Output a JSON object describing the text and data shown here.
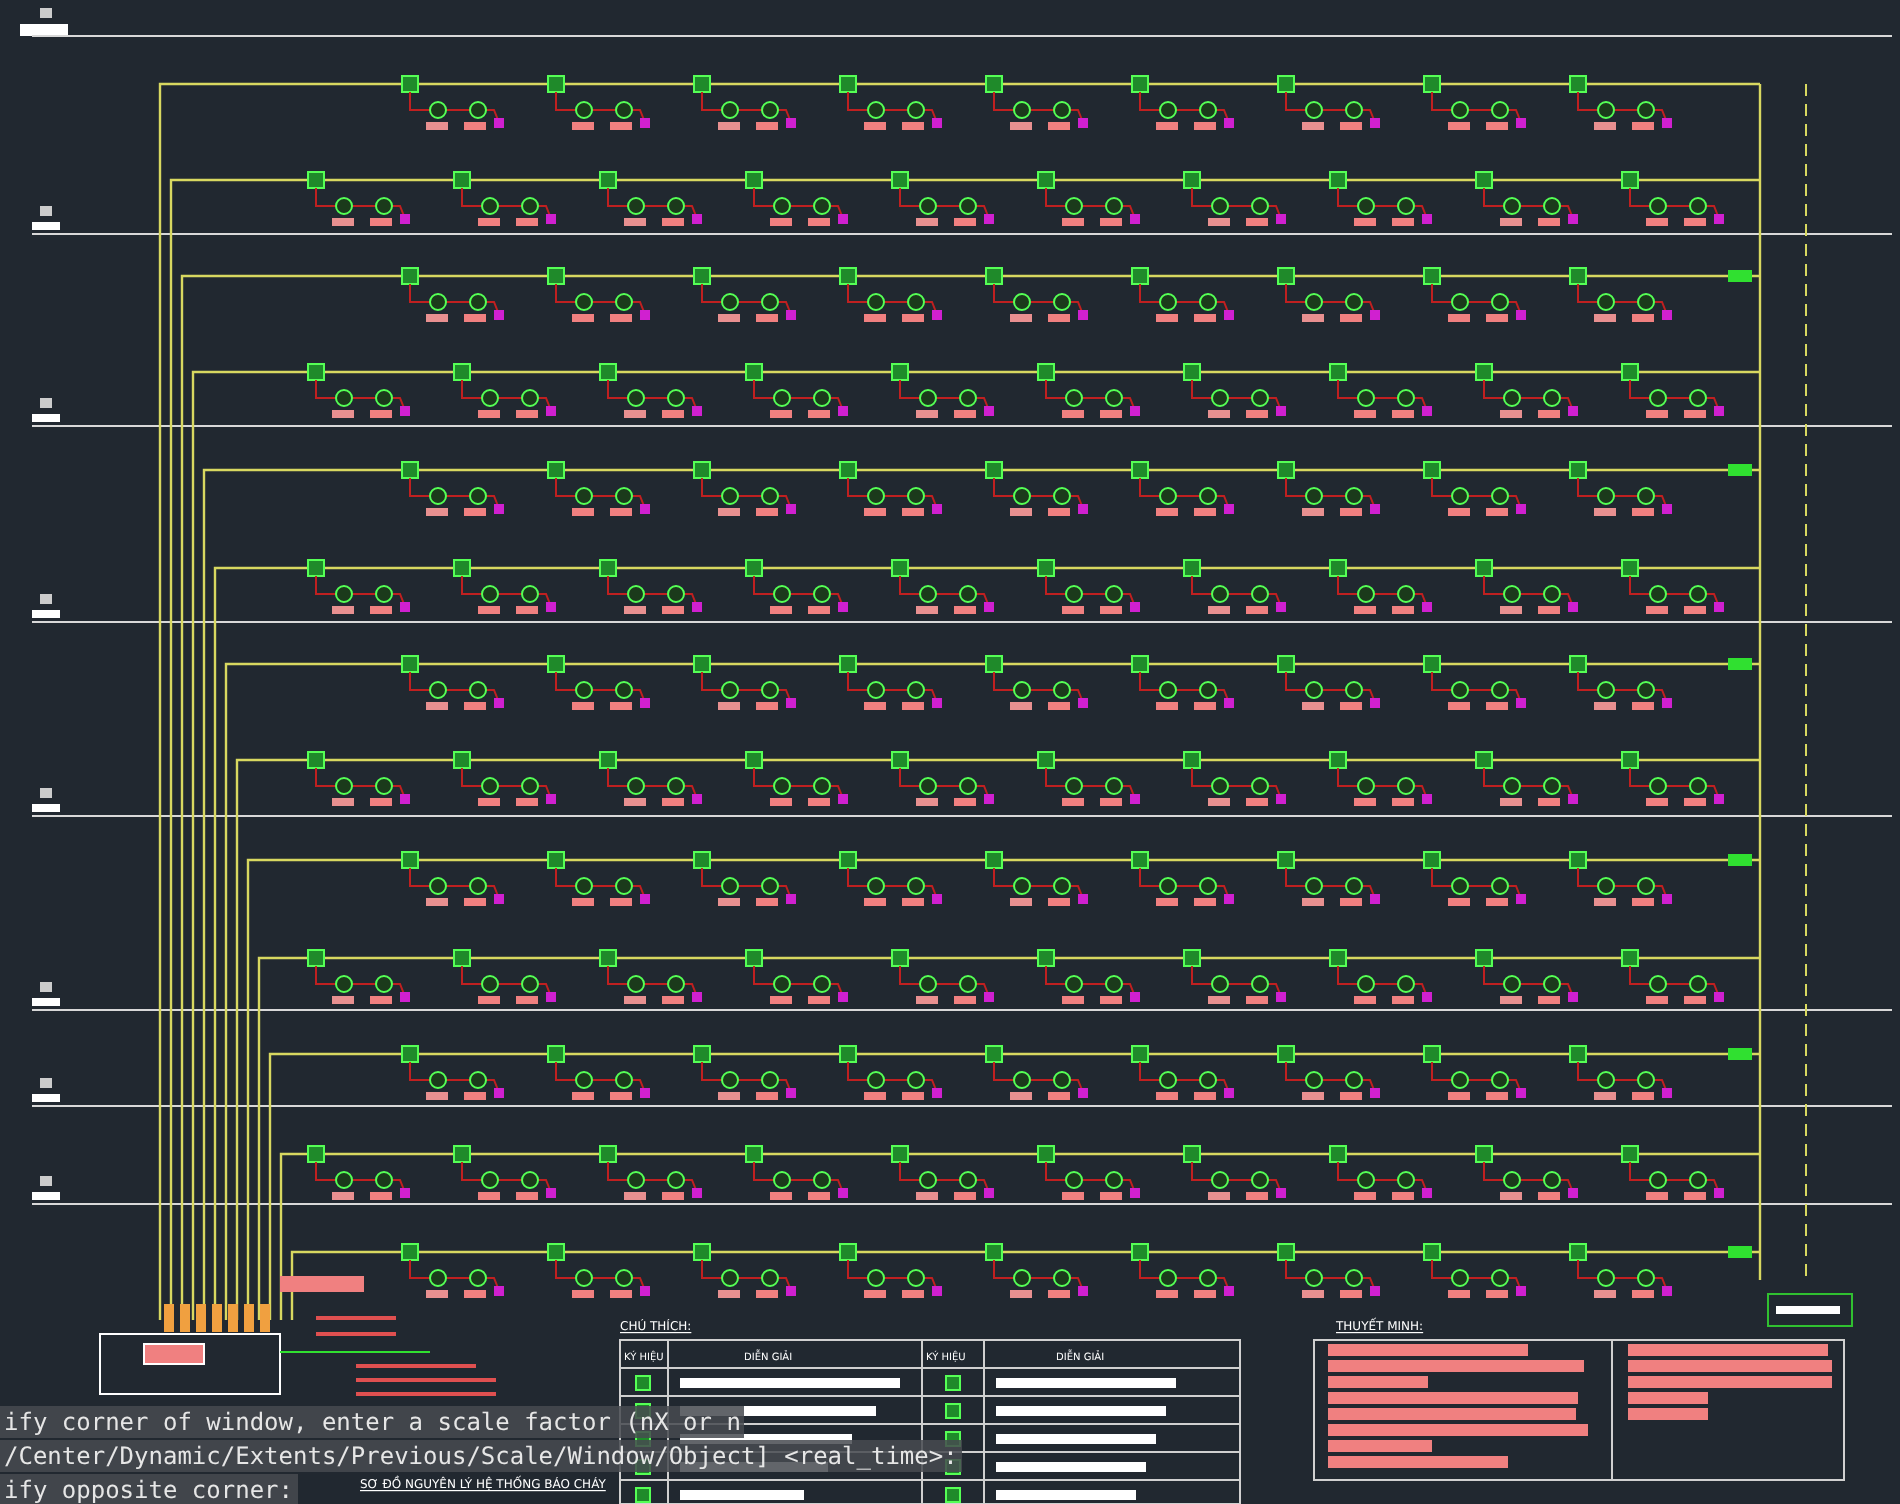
{
  "drawing": {
    "title": "SƠ ĐỒ NGUYÊN LÝ HỆ THỐNG BÁO CHÁY"
  },
  "legend": {
    "title": "CHÚ THÍCH:",
    "columns": [
      "KÝ HIỆU",
      "DIỄN GIẢI",
      "KÝ HIỆU",
      "DIỄN GIẢI"
    ]
  },
  "notes": {
    "title": "THUYẾT MINH:"
  },
  "command_line": {
    "lines": [
      "ify corner of window, enter a scale factor (nX or n",
      "/Center/Dynamic/Extents/Previous/Scale/Window/Object] <real_time>:",
      "ify opposite corner:"
    ]
  }
}
